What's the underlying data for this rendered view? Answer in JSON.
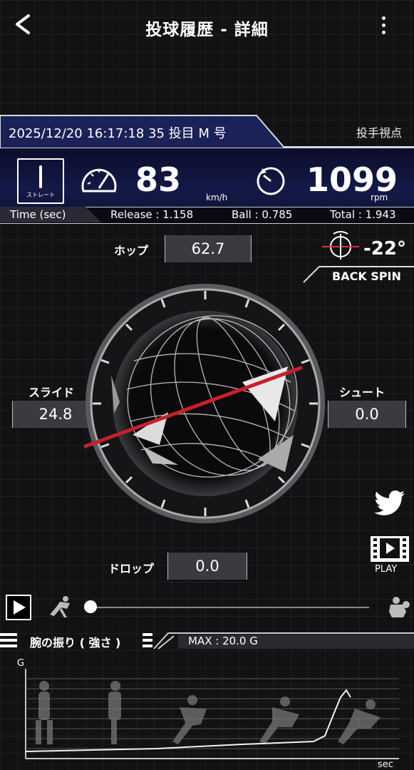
{
  "header": {
    "title": "投球履歴 - 詳細"
  },
  "info": {
    "date": "2025/12/20 16:17:18 35 投目 M 号",
    "view_mode": "投手視点"
  },
  "pitch": {
    "type_label": "ストレート",
    "speed": "83",
    "speed_unit": "km/h",
    "spin": "1099",
    "spin_unit": "rpm"
  },
  "timeline": {
    "label": "Time (sec)",
    "release": "Release : 1.158",
    "ball": "Ball : 0.785",
    "total": "Total : 1.943"
  },
  "movement": {
    "hop_label": "ホップ",
    "hop_value": "62.7",
    "slide_label": "スライド",
    "slide_value": "24.8",
    "shoot_label": "シュート",
    "shoot_value": "0.0",
    "drop_label": "ドロップ",
    "drop_value": "0.0"
  },
  "spin_axis": {
    "tilt": "-22°",
    "type": "BACK SPIN"
  },
  "actions": {
    "play_label": "PLAY"
  },
  "playback": {
    "position": 0.0
  },
  "arm": {
    "title": "腕の振り ( 強さ )",
    "max": "MAX : 20.0 G",
    "y_label": "G",
    "x_label": "sec"
  },
  "icons": [
    "back-icon",
    "more-icon",
    "speedometer-icon",
    "spin-icon",
    "tilt-icon",
    "twitter-icon",
    "film-icon",
    "play-icon",
    "pitcher-start-icon",
    "catcher-icon"
  ],
  "colors": {
    "accent_axis": "#c8202a",
    "band": "#141a48",
    "value_box": "#3b3b3f"
  }
}
